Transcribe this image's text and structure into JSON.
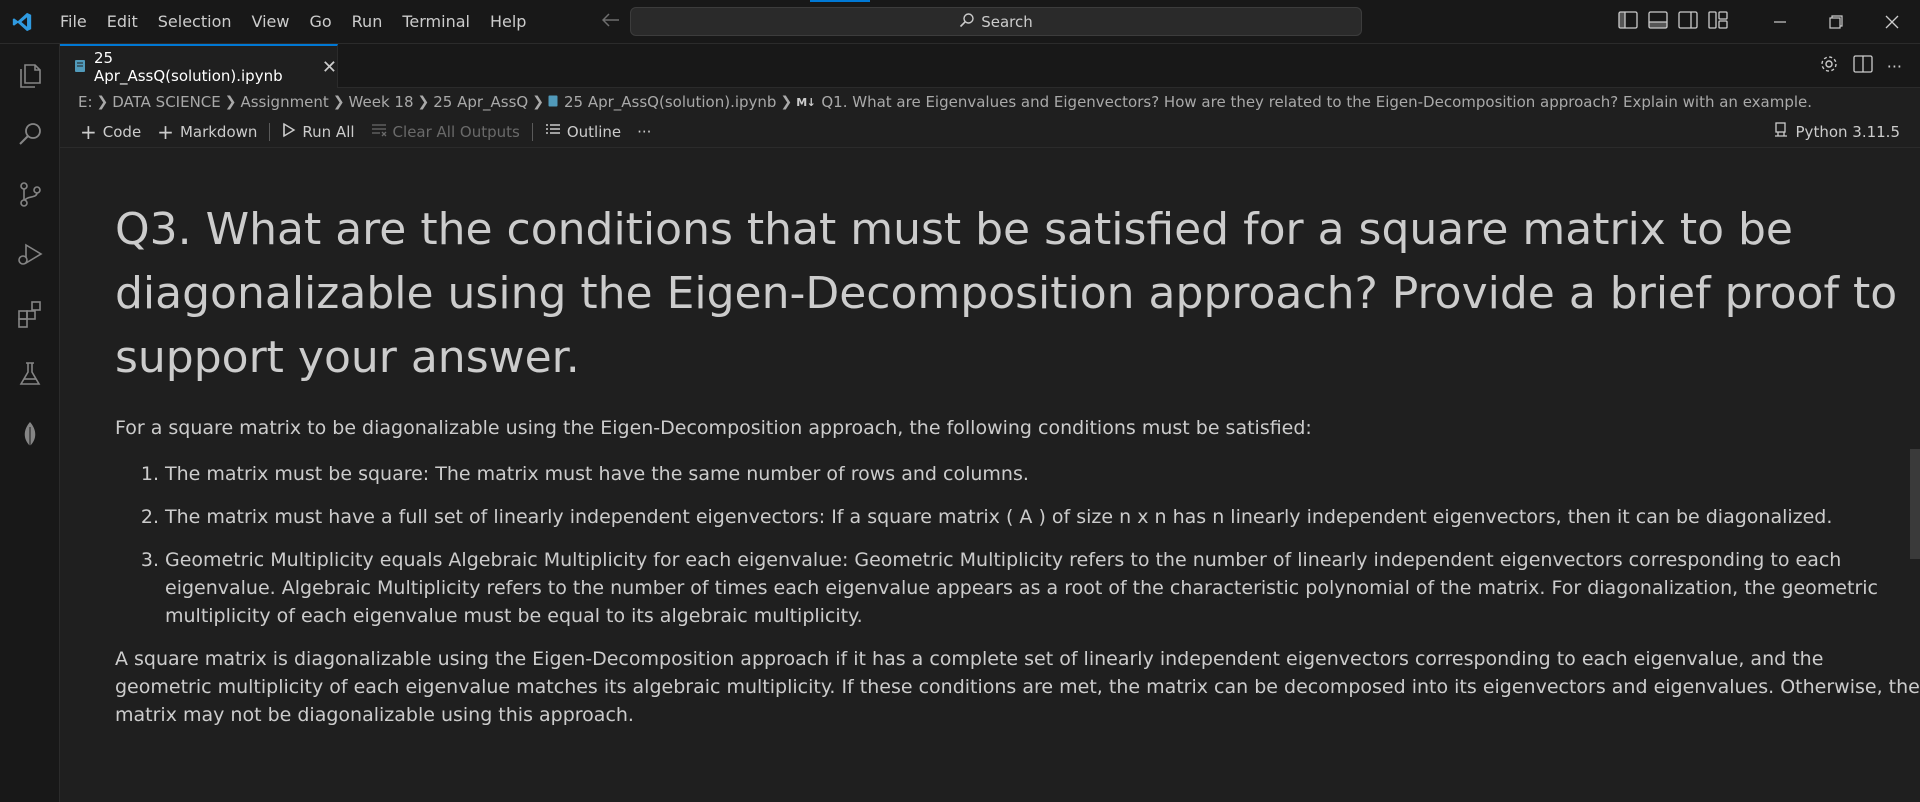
{
  "menu": [
    "File",
    "Edit",
    "Selection",
    "View",
    "Go",
    "Run",
    "Terminal",
    "Help"
  ],
  "search": {
    "label": "Search"
  },
  "tab": {
    "label": "25 Apr_AssQ(solution).ipynb"
  },
  "breadcrumb": {
    "items": [
      "E:",
      "DATA SCIENCE",
      "Assignment",
      "Week 18",
      "25 Apr_AssQ"
    ],
    "file": "25 Apr_AssQ(solution).ipynb",
    "md_badge": "M↓",
    "section": "Q1. What are Eigenvalues and Eigenvectors? How are they related to the Eigen-Decomposition approach? Explain with an example."
  },
  "toolbar": {
    "code": "Code",
    "markdown": "Markdown",
    "run_all": "Run All",
    "clear_outputs": "Clear All Outputs",
    "outline": "Outline",
    "more": "···",
    "kernel": "Python 3.11.5"
  },
  "cell": {
    "heading": "Q3. What are the conditions that must be satisfied for a square matrix to be diagonalizable using the Eigen-Decomposition approach? Provide a brief proof to support your answer.",
    "intro": "For a square matrix to be diagonalizable using the Eigen-Decomposition approach, the following conditions must be satisfied:",
    "list": [
      {
        "num": "1.",
        "text": "The matrix must be square: The matrix must have the same number of rows and columns."
      },
      {
        "num": "2.",
        "text": "The matrix must have a full set of linearly independent eigenvectors: If a square matrix ( A ) of size n x n has n linearly independent eigenvectors, then it can be diagonalized."
      },
      {
        "num": "3.",
        "text": "Geometric Multiplicity equals Algebraic Multiplicity for each eigenvalue: Geometric Multiplicity refers to the number of linearly independent eigenvectors corresponding to each eigenvalue. Algebraic Multiplicity refers to the number of times each eigenvalue appears as a root of the characteristic polynomial of the matrix. For diagonalization, the geometric multiplicity of each eigenvalue must be equal to its algebraic multiplicity."
      }
    ],
    "conclusion": "A square matrix is diagonalizable using the Eigen-Decomposition approach if it has a complete set of linearly independent eigenvectors corresponding to each eigenvalue, and the geometric multiplicity of each eigenvalue matches its algebraic multiplicity. If these conditions are met, the matrix can be decomposed into its eigenvectors and eigenvalues. Otherwise, the matrix may not be diagonalizable using this approach."
  },
  "colors": {
    "accent": "#0078d4",
    "background": "#1f1f1f",
    "chrome": "#181818",
    "text": "#cccccc"
  },
  "icons": [
    "vscode-logo-icon",
    "back-arrow-icon",
    "forward-arrow-icon",
    "search-icon",
    "toggle-primary-sidebar-icon",
    "toggle-panel-icon",
    "toggle-secondary-sidebar-icon",
    "customize-layout-icon",
    "minimize-icon",
    "restore-icon",
    "close-icon",
    "explorer-icon",
    "search-view-icon",
    "source-control-icon",
    "run-debug-icon",
    "extensions-icon",
    "testing-icon",
    "leaf-icon",
    "notebook-file-icon",
    "settings-gear-icon",
    "split-editor-icon",
    "play-icon",
    "clear-outputs-icon",
    "outline-icon",
    "kernel-icon"
  ]
}
